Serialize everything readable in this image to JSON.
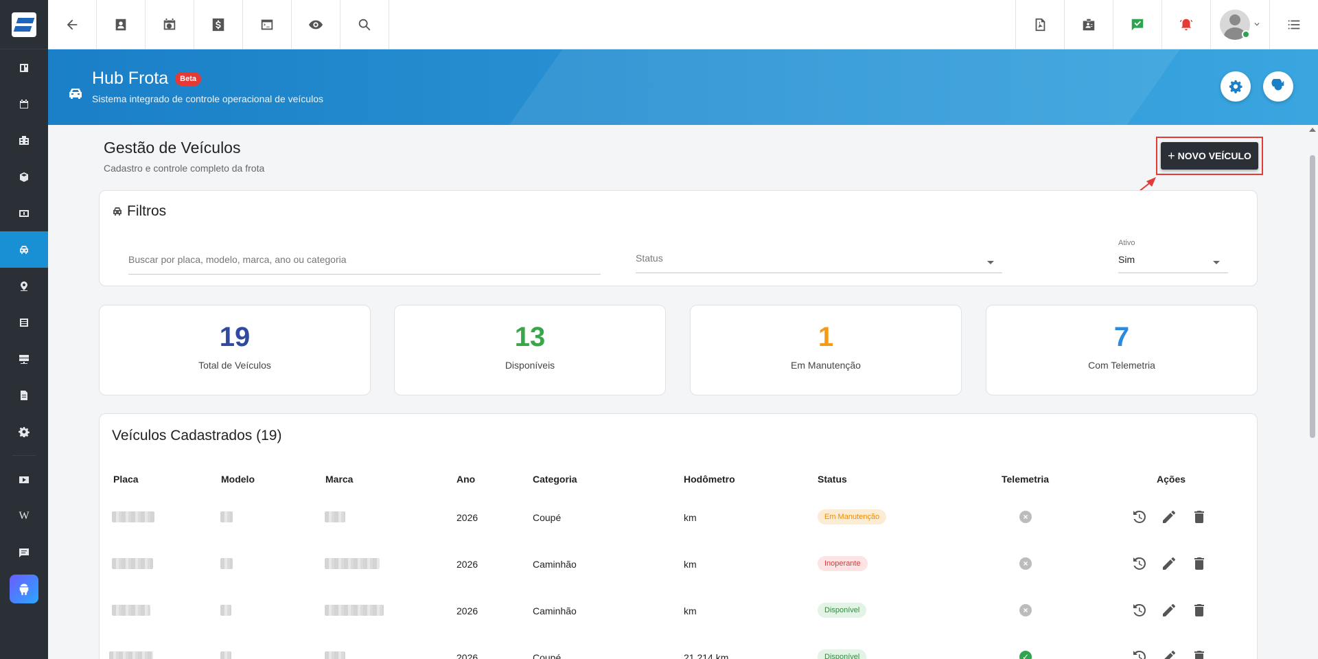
{
  "header": {
    "title": "Hub Frota",
    "badge": "Beta",
    "subtitle": "Sistema integrado de controle operacional de veículos"
  },
  "page": {
    "title": "Gestão de Veículos",
    "subtitle": "Cadastro e controle completo da frota",
    "new_button": "NOVO VEÍCULO"
  },
  "filters": {
    "title": "Filtros",
    "search_placeholder": "Buscar por placa, modelo, marca, ano ou categoria",
    "status_placeholder": "Status",
    "ativo_label": "Ativo",
    "ativo_value": "Sim"
  },
  "stats": [
    {
      "value": "19",
      "label": "Total de Veículos",
      "color": "#2f4aa0"
    },
    {
      "value": "13",
      "label": "Disponíveis",
      "color": "#3aa64a"
    },
    {
      "value": "1",
      "label": "Em Manutenção",
      "color": "#f59a16"
    },
    {
      "value": "7",
      "label": "Com Telemetria",
      "color": "#2a8ae0"
    }
  ],
  "table": {
    "title": "Veículos Cadastrados (19)",
    "columns": [
      "Placa",
      "Modelo",
      "Marca",
      "Ano",
      "Categoria",
      "Hodômetro",
      "Status",
      "Telemetria",
      "Ações"
    ],
    "rows": [
      {
        "ano": "2026",
        "categoria": "Coupé",
        "hodometro": "km",
        "status": "Em Manutenção",
        "telemetria": "off"
      },
      {
        "ano": "2026",
        "categoria": "Caminhão",
        "hodometro": "km",
        "status": "Inoperante",
        "telemetria": "off"
      },
      {
        "ano": "2026",
        "categoria": "Caminhão",
        "hodometro": "km",
        "status": "Disponível",
        "telemetria": "off"
      },
      {
        "ano": "2026",
        "categoria": "Coupé",
        "hodometro": "21.214 km",
        "status": "Disponível",
        "telemetria": "on"
      }
    ]
  },
  "colors": {
    "accent": "#1a90d4",
    "sidebar": "#2b2f36",
    "status_manutencao": "#f59a16",
    "status_inoperante": "#e53935",
    "status_disponivel": "#3aa64a"
  }
}
